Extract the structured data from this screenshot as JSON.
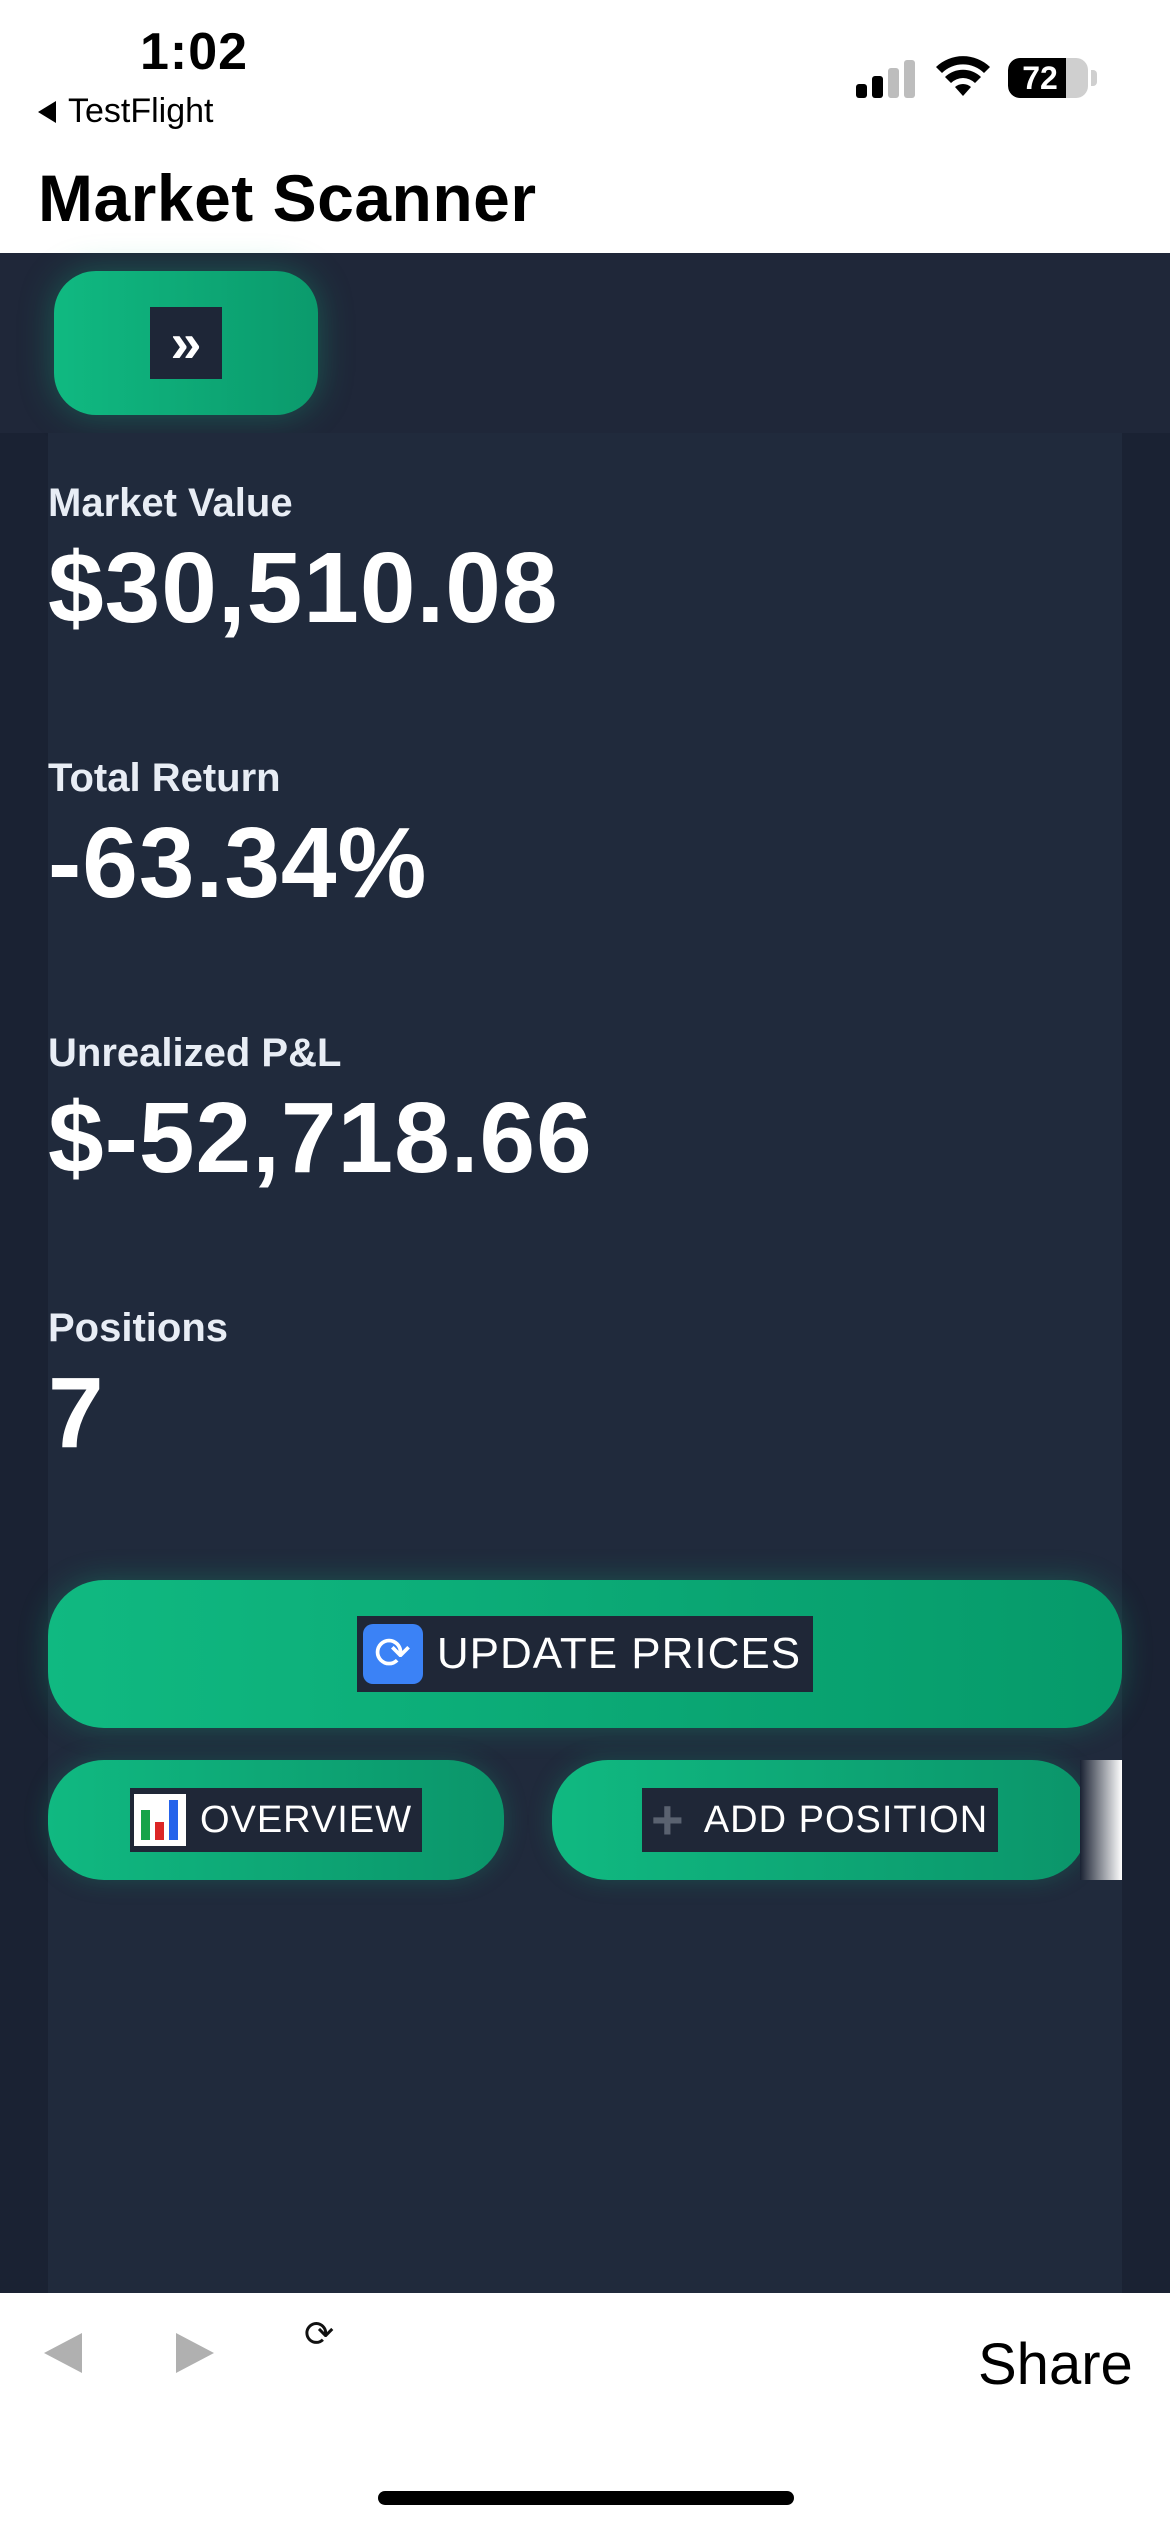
{
  "status_bar": {
    "time": "1:02",
    "back_app": "TestFlight",
    "battery": "72"
  },
  "header": {
    "title": "Market Scanner"
  },
  "toolbar": {
    "expand_glyph": "»"
  },
  "metrics": [
    {
      "label": "Market Value",
      "value": "$30,510.08"
    },
    {
      "label": "Total Return",
      "value": "-63.34%"
    },
    {
      "label": "Unrealized P&L",
      "value": "$-52,718.66"
    },
    {
      "label": "Positions",
      "value": "7"
    }
  ],
  "actions": {
    "update_prices": "UPDATE PRICES",
    "overview": "OVERVIEW",
    "add_position": "ADD POSITION"
  },
  "browser": {
    "share": "Share"
  },
  "colors": {
    "accent": "#10b981",
    "app_bg": "#1a2233",
    "panel_bg": "#202a3c"
  }
}
